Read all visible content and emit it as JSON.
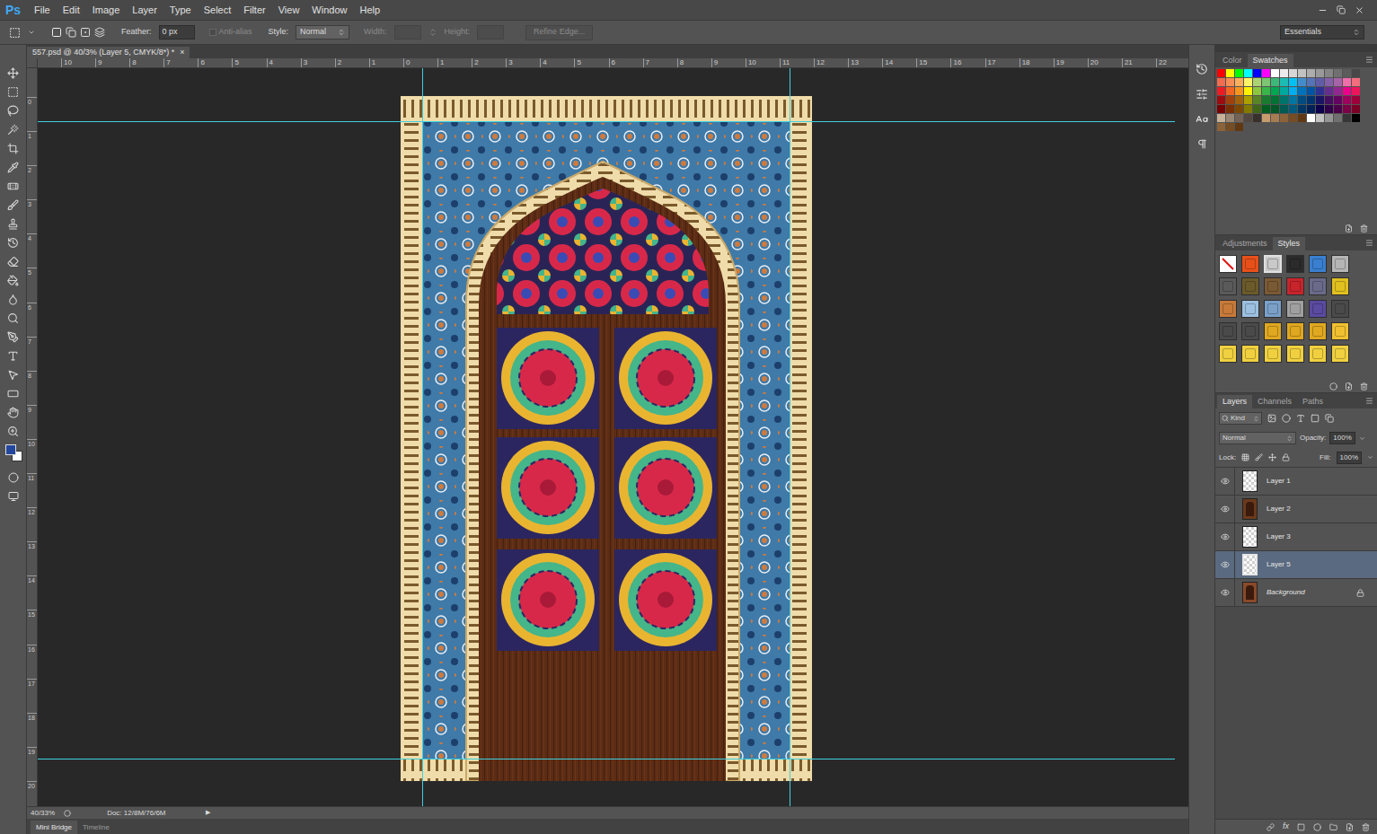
{
  "app": {
    "logo": "Ps"
  },
  "menu": [
    "File",
    "Edit",
    "Image",
    "Layer",
    "Type",
    "Select",
    "Filter",
    "View",
    "Window",
    "Help"
  ],
  "options_bar": {
    "feather_label": "Feather:",
    "feather_value": "0 px",
    "anti_alias": {
      "label": "Anti-alias",
      "checked": false,
      "disabled": true
    },
    "style_label": "Style:",
    "style_value": "Normal",
    "width": {
      "label": "Width:",
      "disabled": true
    },
    "height": {
      "label": "Height:",
      "disabled": true
    },
    "refine_edge": {
      "label": "Refine Edge...",
      "disabled": true
    },
    "workspace": "Essentials"
  },
  "document_tab": {
    "title": "557.psd @ 40/3% (Layer 5, CMYK/8*) *",
    "close": "×"
  },
  "rulers": {
    "top": [
      "10",
      "9",
      "8",
      "7",
      "6",
      "5",
      "4",
      "3",
      "2",
      "1",
      "0",
      "1",
      "2",
      "3",
      "4",
      "5",
      "6",
      "7",
      "8",
      "9",
      "10",
      "11",
      "12",
      "13",
      "14",
      "15",
      "16",
      "17",
      "18",
      "19",
      "20",
      "21",
      "22"
    ],
    "left": [
      "0",
      "1",
      "2",
      "3",
      "4",
      "5",
      "6",
      "7",
      "8",
      "9",
      "10",
      "11",
      "12",
      "13",
      "14",
      "15",
      "16",
      "17",
      "18",
      "19",
      "20"
    ]
  },
  "status_bar": {
    "zoom": "40/33%",
    "doc": "Doc: 12/8M/76/6M",
    "arrow": "▶"
  },
  "bottom_tabs": [
    {
      "label": "Mini Bridge",
      "selected": true
    },
    {
      "label": "Timeline",
      "selected": false
    }
  ],
  "swatches_panel": {
    "tabs": [
      {
        "label": "Color",
        "selected": false
      },
      {
        "label": "Swatches",
        "selected": true
      }
    ],
    "rows": [
      [
        "#ff0000",
        "#ffff00",
        "#00ff00",
        "#00ffff",
        "#0000ff",
        "#ff00ff",
        "#ffffff",
        "#ebebeb",
        "#d6d6d6",
        "#c2c2c2",
        "#adadad",
        "#999999",
        "#858585",
        "#707070",
        "#5c5c5c",
        "#474747"
      ],
      [
        "#f26c4f",
        "#f68e55",
        "#fbaf5c",
        "#fff467",
        "#acd372",
        "#7dc473",
        "#3cb878",
        "#1cbbb4",
        "#00bff3",
        "#438ccb",
        "#5573b7",
        "#605ca8",
        "#855fa8",
        "#a763a8",
        "#f06ea9",
        "#f26d7d"
      ],
      [
        "#ed1c24",
        "#f26522",
        "#f7941d",
        "#fff200",
        "#8dc63f",
        "#39b54a",
        "#00a651",
        "#00a99d",
        "#00aeef",
        "#0072bc",
        "#0054a6",
        "#2e3192",
        "#662d91",
        "#92278f",
        "#ec008c",
        "#ed145b"
      ],
      [
        "#9e0b0f",
        "#a0410d",
        "#a36209",
        "#aba000",
        "#598527",
        "#1a7b30",
        "#007236",
        "#00746b",
        "#0076a3",
        "#004b80",
        "#003471",
        "#1b1464",
        "#440e62",
        "#630460",
        "#9e005d",
        "#9e0039"
      ],
      [
        "#790000",
        "#7b2e00",
        "#7d4900",
        "#827b00",
        "#406618",
        "#005e20",
        "#005826",
        "#005952",
        "#005b7f",
        "#003663",
        "#002157",
        "#0d004c",
        "#32004b",
        "#4b0049",
        "#7b0046",
        "#7a0026"
      ],
      [
        "#c7b299",
        "#998675",
        "#736357",
        "#534741",
        "#37302d",
        "#c69c6d",
        "#a67c52",
        "#8c6239",
        "#754c24",
        "#603913",
        "#ffffff",
        "#c2c2c2",
        "#959595",
        "#707070",
        "#363636",
        "#000000"
      ],
      [
        "#8c6239",
        "#754c24",
        "#603913"
      ]
    ]
  },
  "styles_panel": {
    "tabs": [
      {
        "label": "Adjustments",
        "selected": false
      },
      {
        "label": "Styles",
        "selected": true
      }
    ],
    "styles": [
      {
        "color": "#ffffff",
        "kind": "none",
        "selected": false
      },
      {
        "color": "#e8501a",
        "kind": "style",
        "selected": false
      },
      {
        "color": "#c9c9c9",
        "kind": "style",
        "selected": true
      },
      {
        "color": "#2b2b2b",
        "kind": "style",
        "selected": false
      },
      {
        "color": "#3a7fd0",
        "kind": "style",
        "selected": false
      },
      {
        "color": "#b5b5b5",
        "kind": "style",
        "selected": false
      },
      {
        "color": "#5a5a5a",
        "kind": "style",
        "selected": false
      },
      {
        "color": "#6b5a2a",
        "kind": "style",
        "selected": false
      },
      {
        "color": "#7a5a34",
        "kind": "style",
        "selected": false
      },
      {
        "color": "#c8242c",
        "kind": "style",
        "selected": false
      },
      {
        "color": "#6a6a8a",
        "kind": "style",
        "selected": false
      },
      {
        "color": "#e0c020",
        "kind": "style",
        "selected": false
      },
      {
        "color": "#c87a3a",
        "kind": "style",
        "selected": false
      },
      {
        "color": "#9cc0e0",
        "kind": "style",
        "selected": false
      },
      {
        "color": "#7aa0c8",
        "kind": "style",
        "selected": false
      },
      {
        "color": "#a0a0a0",
        "kind": "style",
        "selected": false
      },
      {
        "color": "#5a4aa0",
        "kind": "style",
        "selected": false
      },
      {
        "color": "#4a4a4a",
        "kind": "style",
        "selected": false
      },
      {
        "color": "#4a4a4a",
        "kind": "style",
        "selected": false
      },
      {
        "color": "#4a4a4a",
        "kind": "style",
        "selected": false
      },
      {
        "color": "#e0a820",
        "kind": "style",
        "selected": false
      },
      {
        "color": "#e0a820",
        "kind": "style",
        "selected": false
      },
      {
        "color": "#e0a820",
        "kind": "style",
        "selected": false
      },
      {
        "color": "#f0c030",
        "kind": "style",
        "selected": false
      },
      {
        "color": "#f0d040",
        "kind": "style",
        "selected": false
      },
      {
        "color": "#f0d040",
        "kind": "style",
        "selected": false
      },
      {
        "color": "#f0d040",
        "kind": "style",
        "selected": false
      },
      {
        "color": "#f0d040",
        "kind": "style",
        "selected": false
      },
      {
        "color": "#f0d040",
        "kind": "style",
        "selected": false
      },
      {
        "color": "#f0d040",
        "kind": "style",
        "selected": false
      }
    ]
  },
  "layers_panel": {
    "tabs": [
      {
        "label": "Layers",
        "selected": true
      },
      {
        "label": "Channels",
        "selected": false
      },
      {
        "label": "Paths",
        "selected": false
      }
    ],
    "filter": "Kind",
    "blend_mode": "Normal",
    "opacity_label": "Opacity:",
    "opacity": "100%",
    "lock_label": "Lock:",
    "fill_label": "Fill:",
    "fill": "100%",
    "layers": [
      {
        "name": "Layer 1",
        "visible": true,
        "selected": false,
        "locked": false,
        "kind": "transparent"
      },
      {
        "name": "Layer 2",
        "visible": true,
        "selected": false,
        "locked": false,
        "kind": "image"
      },
      {
        "name": "Layer 3",
        "visible": true,
        "selected": false,
        "locked": false,
        "kind": "transparent"
      },
      {
        "name": "Layer 5",
        "visible": true,
        "selected": true,
        "locked": false,
        "kind": "transparent"
      },
      {
        "name": "Background",
        "visible": true,
        "selected": false,
        "locked": true,
        "kind": "background"
      }
    ],
    "footer_fx": "fx"
  }
}
